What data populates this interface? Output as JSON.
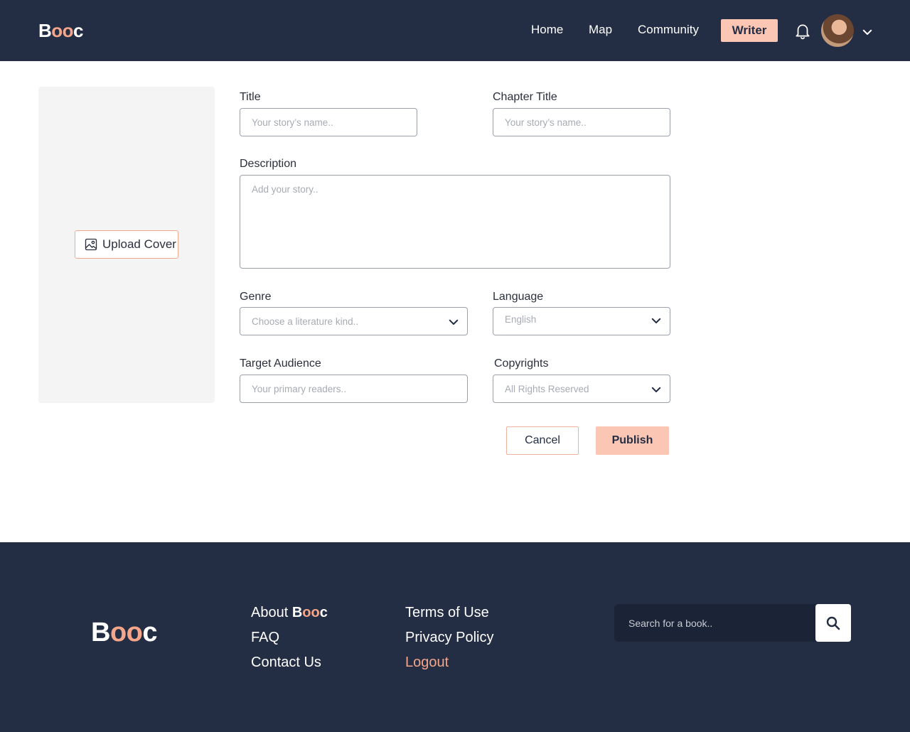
{
  "header": {
    "logo": {
      "prefix": "B",
      "accent": "oo",
      "suffix": "c"
    },
    "nav": [
      {
        "label": "Home"
      },
      {
        "label": "Map"
      },
      {
        "label": "Community"
      }
    ],
    "writer_label": "Writer"
  },
  "cover": {
    "upload_label": "Upload Cover"
  },
  "form": {
    "title": {
      "label": "Title",
      "placeholder": "Your story’s name.."
    },
    "chapter_title": {
      "label": "Chapter Title",
      "placeholder": "Your story’s name.."
    },
    "description": {
      "label": "Description",
      "placeholder": "Add your story.."
    },
    "genre": {
      "label": "Genre",
      "value": "Choose a literature kind.."
    },
    "language": {
      "label": "Language",
      "value": "English"
    },
    "target_audience": {
      "label": "Target Audience",
      "placeholder": "Your primary readers.."
    },
    "copyrights": {
      "label": "Copyrights",
      "value": "All Rights Reserved"
    },
    "cancel_label": "Cancel",
    "publish_label": "Publish"
  },
  "footer": {
    "logo": {
      "prefix": "B",
      "accent": "oo",
      "suffix": "c"
    },
    "about": {
      "prefix": "About ",
      "brand_b": "B",
      "brand_oo": "oo",
      "brand_c": "c"
    },
    "links_col1": [
      {
        "label": "FAQ"
      },
      {
        "label": "Contact Us"
      }
    ],
    "links_col2": [
      {
        "label": "Terms of Use"
      },
      {
        "label": "Privacy Policy"
      }
    ],
    "logout_label": "Logout",
    "search_placeholder": "Search for a book.."
  },
  "colors": {
    "navy": "#232d43",
    "accent": "#fcc6b4",
    "accent_text": "#f4a58a"
  },
  "icons": {
    "bell": "bell-icon",
    "chevron": "chevron-down-icon",
    "image": "image-icon",
    "search": "search-icon"
  }
}
